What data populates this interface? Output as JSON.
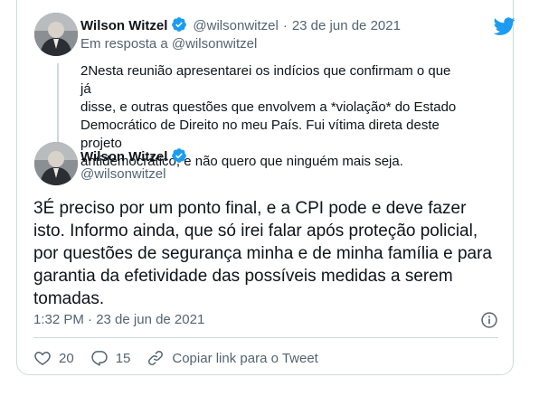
{
  "parent_tweet": {
    "name": "Wilson Witzel",
    "handle": "@wilsonwitzel",
    "separator": "·",
    "date": "23 de jun de 2021",
    "reply_to": "Em resposta a @wilsonwitzel",
    "text": "2Nesta reunião apresentarei os indícios que confirmam o que já\ndisse, e outras questões que envolvem a *violação* do Estado\nDemocrático de Direito no meu País. Fui vítima direta deste projeto\nantidemocrático, e não quero que ninguém mais seja."
  },
  "main_tweet": {
    "name": "Wilson Witzel",
    "handle": "@wilsonwitzel",
    "text": "3É preciso por um ponto final, e a CPI pode e deve fazer\nisto. Informo ainda, que só irei falar após proteção policial,\npor questões de segurança minha e de minha família e para\ngarantia da efetividade das possíveis medidas a serem\ntomadas.",
    "timestamp": "1:32 PM · 23 de jun de 2021"
  },
  "actions": {
    "likes": "20",
    "replies": "15",
    "copy_link": "Copiar link para o Tweet"
  },
  "colors": {
    "accent": "#1d9bf0",
    "muted": "#536471",
    "border": "#cfd9de"
  },
  "icons": [
    "twitter-bird-icon",
    "verified-badge-icon",
    "info-icon",
    "heart-icon",
    "reply-icon",
    "link-icon"
  ]
}
